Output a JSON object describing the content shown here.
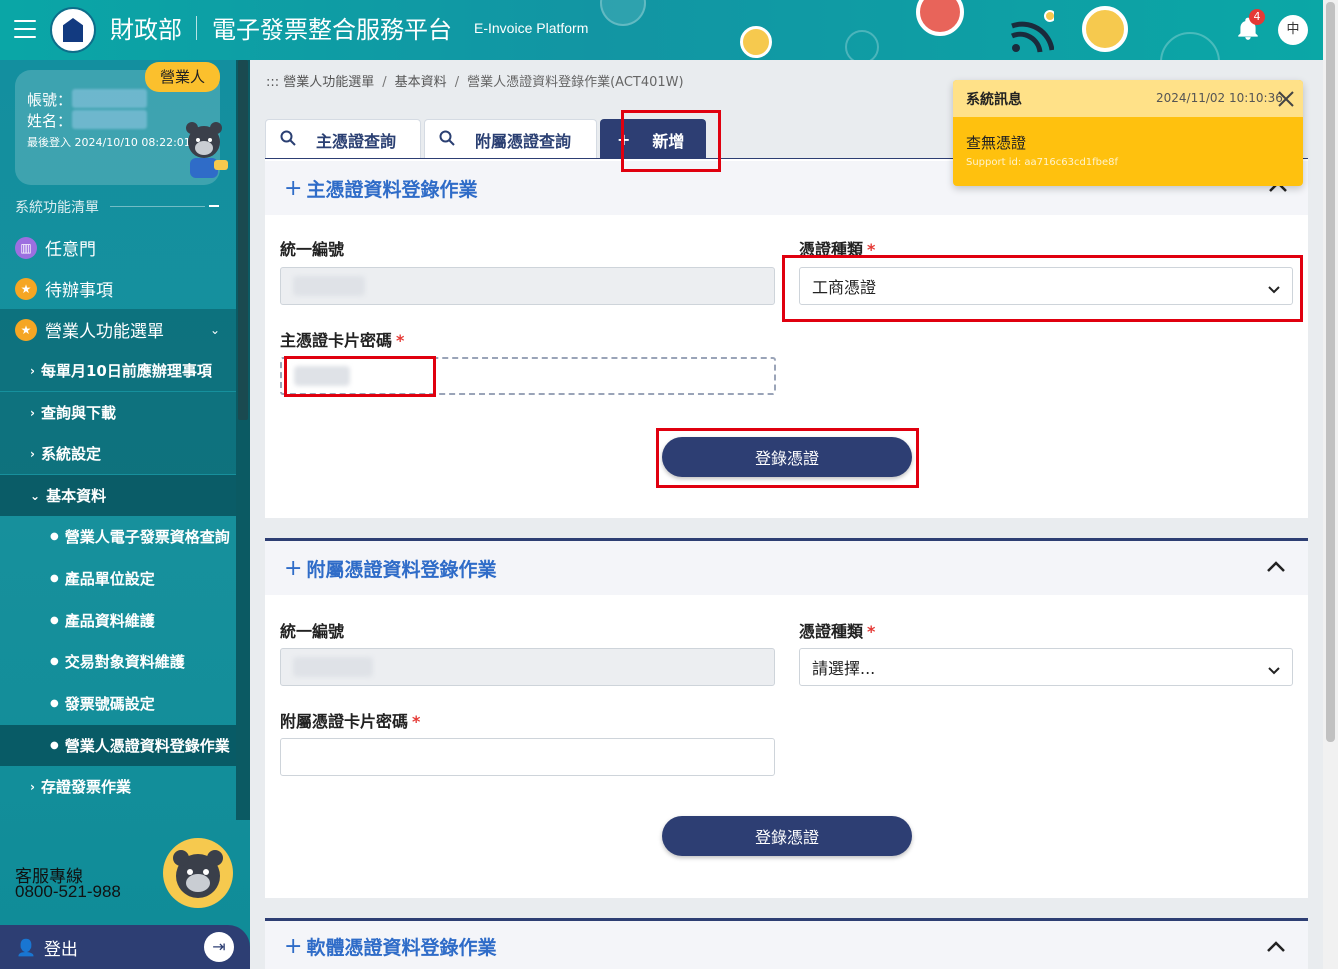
{
  "header": {
    "ministry": "財政部",
    "platform": "電子發票整合服務平台",
    "platform_en": "E-Invoice Platform",
    "notification_count": "4",
    "language": "中"
  },
  "sidebar": {
    "role_badge": "營業人",
    "account_label": "帳號：",
    "name_label": "姓名：",
    "last_login": "最後登入 2024/10/10 08:22:01",
    "menu_title": "系統功能清單",
    "top_items": [
      {
        "label": "任意門",
        "icon": "map-icon",
        "color": "#9c6fe0"
      },
      {
        "label": "待辦事項",
        "icon": "star-icon",
        "color": "#f5a623"
      },
      {
        "label": "營業人功能選單",
        "icon": "star-icon",
        "color": "#f5a623"
      }
    ],
    "sub_items": [
      {
        "label": "每單月10日前應辦理事項"
      },
      {
        "label": "查詢與下載"
      },
      {
        "label": "系統設定"
      },
      {
        "label": "基本資料"
      }
    ],
    "leaf_items": [
      {
        "label": "營業人電子發票資格查詢"
      },
      {
        "label": "產品單位設定"
      },
      {
        "label": "產品資料維護"
      },
      {
        "label": "交易對象資料維護"
      },
      {
        "label": "發票號碼設定"
      },
      {
        "label": "營業人憑證資料登錄作業"
      }
    ],
    "after_item": {
      "label": "存證發票作業"
    },
    "hotline_label": "客服專線",
    "hotline_number": "0800-521-988",
    "logout_label": "登出"
  },
  "breadcrumb": {
    "root": "::: 營業人功能選單",
    "level2": "基本資料",
    "current": "營業人憑證資料登錄作業(ACT401W)"
  },
  "tabs": [
    {
      "label": "主憑證查詢",
      "icon": "search-icon"
    },
    {
      "label": "附屬憑證查詢",
      "icon": "search-icon"
    },
    {
      "label": "新增",
      "icon": "plus-icon"
    }
  ],
  "panels": {
    "main_cert": {
      "title": "主憑證資料登錄作業",
      "tax_id_label": "統一編號",
      "cert_type_label": "憑證種類",
      "cert_type_value": "工商憑證",
      "pin_label": "主憑證卡片密碼",
      "submit_label": "登錄憑證"
    },
    "sub_cert": {
      "title": "附屬憑證資料登錄作業",
      "tax_id_label": "統一編號",
      "cert_type_label": "憑證種類",
      "cert_type_value": "請選擇...",
      "pin_label": "附屬憑證卡片密碼",
      "submit_label": "登錄憑證"
    },
    "soft_cert": {
      "title": "軟體憑證資料登錄作業"
    }
  },
  "toast": {
    "title": "系統訊息",
    "time": "2024/11/02 10:10:36",
    "message": "查無憑證",
    "support": "Support id: aa716c63cd1fbe8f"
  },
  "colors": {
    "primary": "#2d3e73",
    "accent": "#2f6cc8",
    "teal": "#1295a3",
    "toast": "#ffc10e",
    "highlight": "#e0000f"
  }
}
